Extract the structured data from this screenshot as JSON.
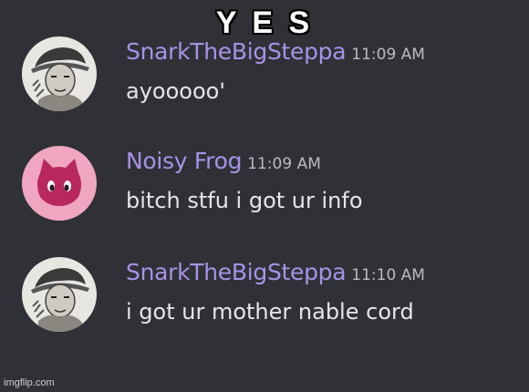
{
  "caption": "Y E S",
  "messages": [
    {
      "username": "SnarkTheBigSteppa",
      "time": "11:09 AM",
      "text": "ayooooo'",
      "avatar": "sketch-portrait-avatar"
    },
    {
      "username": "Noisy Frog",
      "time": "11:09 AM",
      "text": "bitch stfu i got ur info",
      "avatar": "cat-face-avatar"
    },
    {
      "username": "SnarkTheBigSteppa",
      "time": "11:10 AM",
      "text": "i got ur mother nable cord",
      "avatar": "sketch-portrait-avatar"
    }
  ],
  "colors": {
    "background": "#2f3136",
    "username": "#a892e8",
    "timestamp": "#b9bbbe",
    "message_text": "#e6e6e6",
    "cat_avatar_bg": "#f0a6c0",
    "cat_face": "#b8285e"
  },
  "watermark": "imgflip.com"
}
